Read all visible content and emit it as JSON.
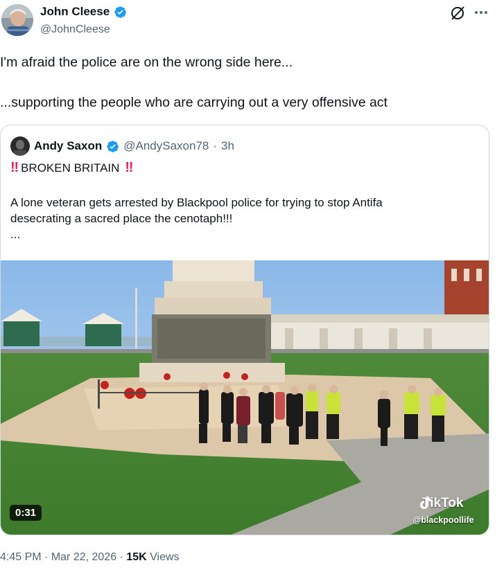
{
  "author": {
    "display_name": "John Cleese",
    "handle": "@JohnCleese",
    "verified": true
  },
  "header_icons": {
    "grok": "grok-icon",
    "more": "more-icon"
  },
  "tweet": {
    "line1": "I'm afraid the police are on the wrong side here...",
    "line2": "...supporting the people who are carrying out a very offensive act"
  },
  "quoted": {
    "display_name": "Andy Saxon",
    "handle": "@AndySaxon78",
    "separator": "·",
    "time": "3h",
    "emoji": "‼",
    "title": "BROKEN BRITAIN",
    "body_line1": "A lone veteran gets arrested by Blackpool police for trying to stop Antifa",
    "body_line2": "desecrating a sacred place the cenotaph!!!",
    "ellipsis": "...",
    "video": {
      "duration": "0:31",
      "watermark": "TikTok",
      "watermark_handle": "@blackpoollife"
    }
  },
  "meta": {
    "time": "4:45 PM",
    "sep1": "·",
    "date": "Mar 22, 2026",
    "sep2": "·",
    "views_count": "15K",
    "views_label": "Views"
  },
  "colors": {
    "verified_blue": "#1d9bf0",
    "text": "#0f1419",
    "secondary": "#536471",
    "border": "#cfd9de",
    "emoji_red": "#e0245e"
  }
}
